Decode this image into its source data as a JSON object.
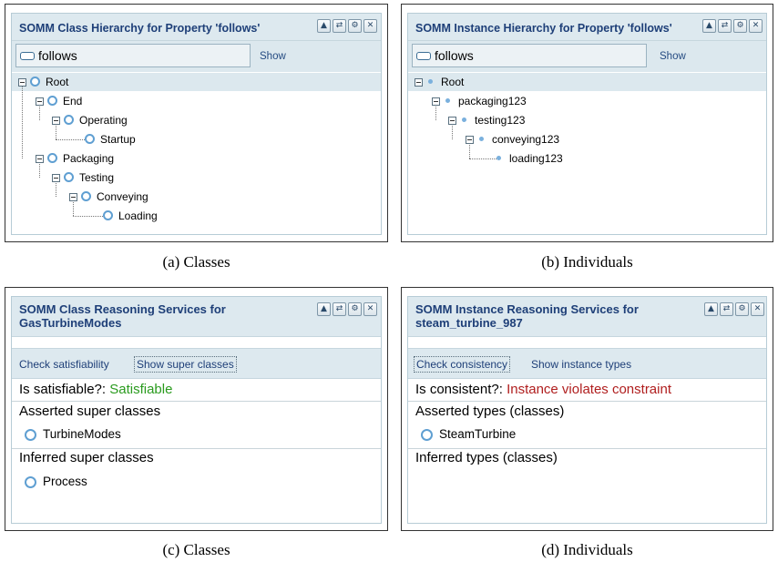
{
  "panels": {
    "a": {
      "title": "SOMM Class Hierarchy for Property 'follows'",
      "search_value": "follows",
      "show_label": "Show",
      "caption": "(a) Classes",
      "tree": [
        "Root",
        "End",
        "Operating",
        "Startup",
        "Packaging",
        "Testing",
        "Conveying",
        "Loading"
      ]
    },
    "b": {
      "title": "SOMM Instance Hierarchy for Property 'follows'",
      "search_value": "follows",
      "show_label": "Show",
      "caption": "(b) Individuals",
      "tree": [
        "Root",
        "packaging123",
        "testing123",
        "conveying123",
        "loading123"
      ]
    },
    "c": {
      "title_line1": "SOMM Class Reasoning Services for",
      "title_line2": "GasTurbineModes",
      "action1": "Check satisfiability",
      "action2": "Show super classes",
      "result_label": "Is satisfiable?:",
      "result_value": "Satisfiable",
      "section1": "Asserted super classes",
      "section1_items": [
        "TurbineModes"
      ],
      "section2": "Inferred super classes",
      "section2_items": [
        "Process"
      ],
      "caption": "(c) Classes"
    },
    "d": {
      "title_line1": "SOMM Instance Reasoning Services for",
      "title_line2": "steam_turbine_987",
      "action1": "Check consistency",
      "action2": "Show instance types",
      "result_label": "Is consistent?:",
      "result_value": "Instance violates constraint",
      "section1": "Asserted types (classes)",
      "section1_items": [
        "SteamTurbine"
      ],
      "section2": "Inferred types (classes)",
      "caption": "(d) Individuals"
    }
  },
  "icons": {
    "panel_buttons": [
      "collapse-icon",
      "refresh-icon",
      "settings-icon",
      "close-icon"
    ],
    "tree_class": "class-ring-icon",
    "tree_instance": "instance-dot-icon",
    "search": "search-field-icon"
  },
  "colors": {
    "title": "#1e3f78",
    "header_bg": "#dde9ef",
    "satisfiable": "#2a9b1e",
    "violation": "#b01e1e",
    "ring": "#5f9fd2"
  }
}
